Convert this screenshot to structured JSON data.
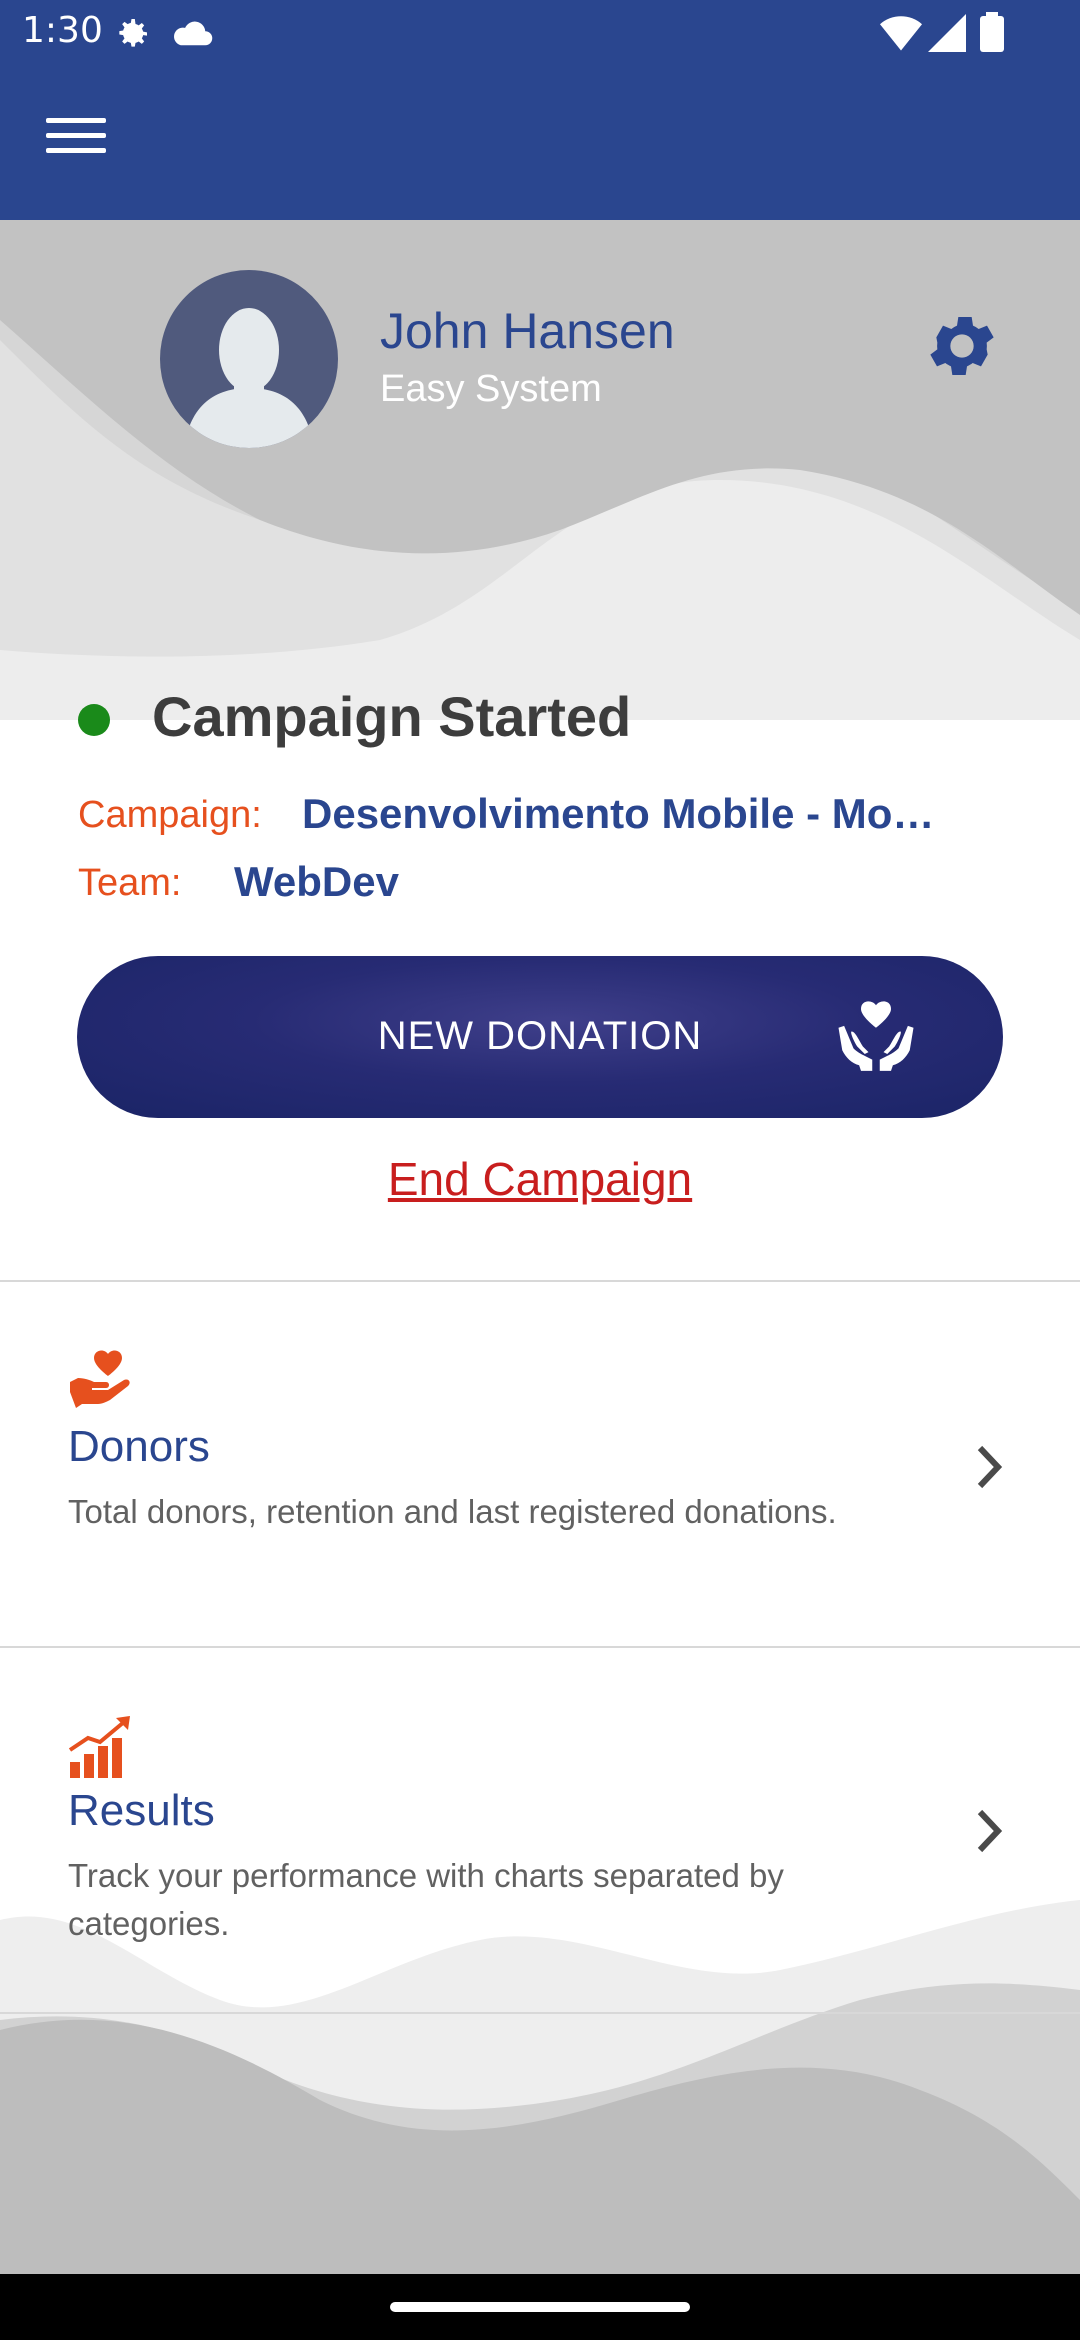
{
  "status_bar": {
    "time": "1:30",
    "icons": [
      "gear-icon",
      "cloud-icon",
      "wifi-icon",
      "signal-icon",
      "battery-icon"
    ]
  },
  "app_bar": {
    "menu_icon": "hamburger-menu-icon"
  },
  "profile": {
    "name": "John Hansen",
    "organization": "Easy System",
    "settings_icon": "gear-icon"
  },
  "campaign": {
    "status": "Campaign Started",
    "status_color": "#1a8a1a",
    "campaign_label": "Campaign:",
    "campaign_value": "Desenvolvimento Mobile - Mo…",
    "team_label": "Team:",
    "team_value": "WebDev",
    "new_donation_label": "NEW DONATION",
    "new_donation_icon": "heart-hands-icon",
    "end_campaign_label": "End Campaign"
  },
  "menu": [
    {
      "title": "Donors",
      "description": "Total donors, retention and last registered donations.",
      "icon": "heart-hand-icon"
    },
    {
      "title": "Results",
      "description": "Track your performance with charts separated by categories.",
      "icon": "bar-chart-growth-icon"
    }
  ],
  "colors": {
    "primary": "#2a468f",
    "accent": "#e6501e",
    "danger": "#c81e1e",
    "button": "#272b74"
  }
}
